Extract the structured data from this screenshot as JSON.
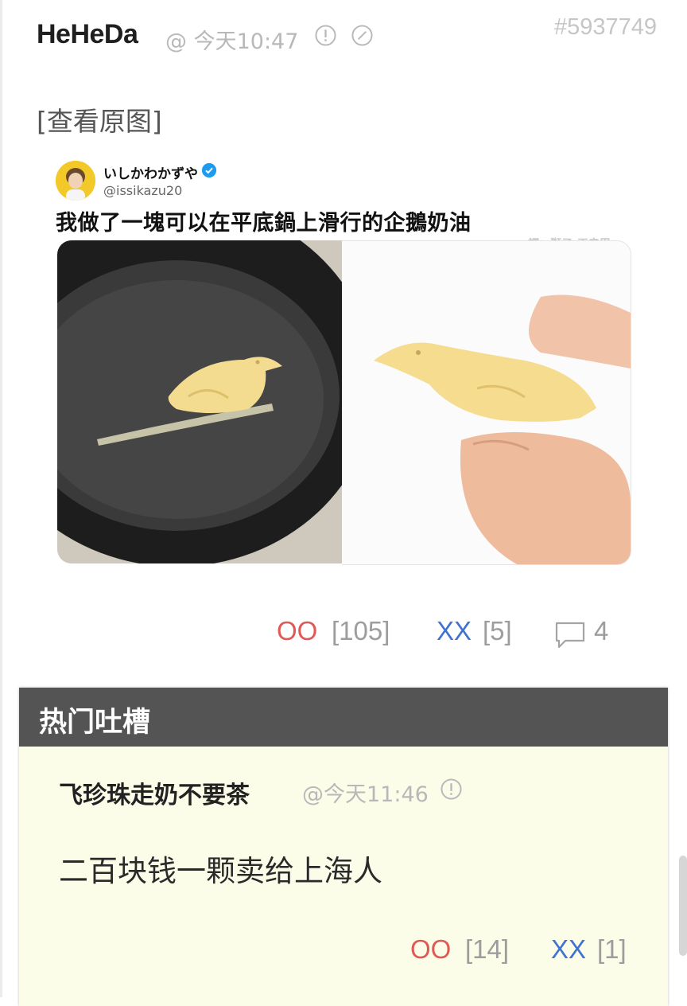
{
  "post": {
    "author": "HeHeDa",
    "meta": "@ 今天10:47",
    "id": "#5937749",
    "view_original": "[查看原图]",
    "image": {
      "name": "いしかわかずや",
      "handle": "@issikazu20",
      "text": "我做了一塊可以在平底鍋上滑行的企鵝奶油",
      "watermark": "譯：獅子-王辛巴"
    },
    "actions": {
      "oo_label": "OO",
      "oo_count": "[105]",
      "xx_label": "XX",
      "xx_count": "[5]",
      "comment_count": "4"
    }
  },
  "hot_comments": {
    "title": "热门吐槽",
    "items": [
      {
        "author": "飞珍珠走奶不要茶",
        "time": "@今天11:46",
        "text": "二百块钱一颗卖给上海人",
        "oo_label": "OO",
        "oo_count": "[14]",
        "xx_label": "XX",
        "xx_count": "[1]"
      }
    ]
  },
  "colors": {
    "oo": "#e05a55",
    "xx": "#3e73d1",
    "muted": "#9d9d9d",
    "panel_bg": "#fbfde8",
    "panel_header": "#545454"
  },
  "icons": [
    "report-icon",
    "block-icon",
    "verified-icon",
    "comment-icon"
  ]
}
